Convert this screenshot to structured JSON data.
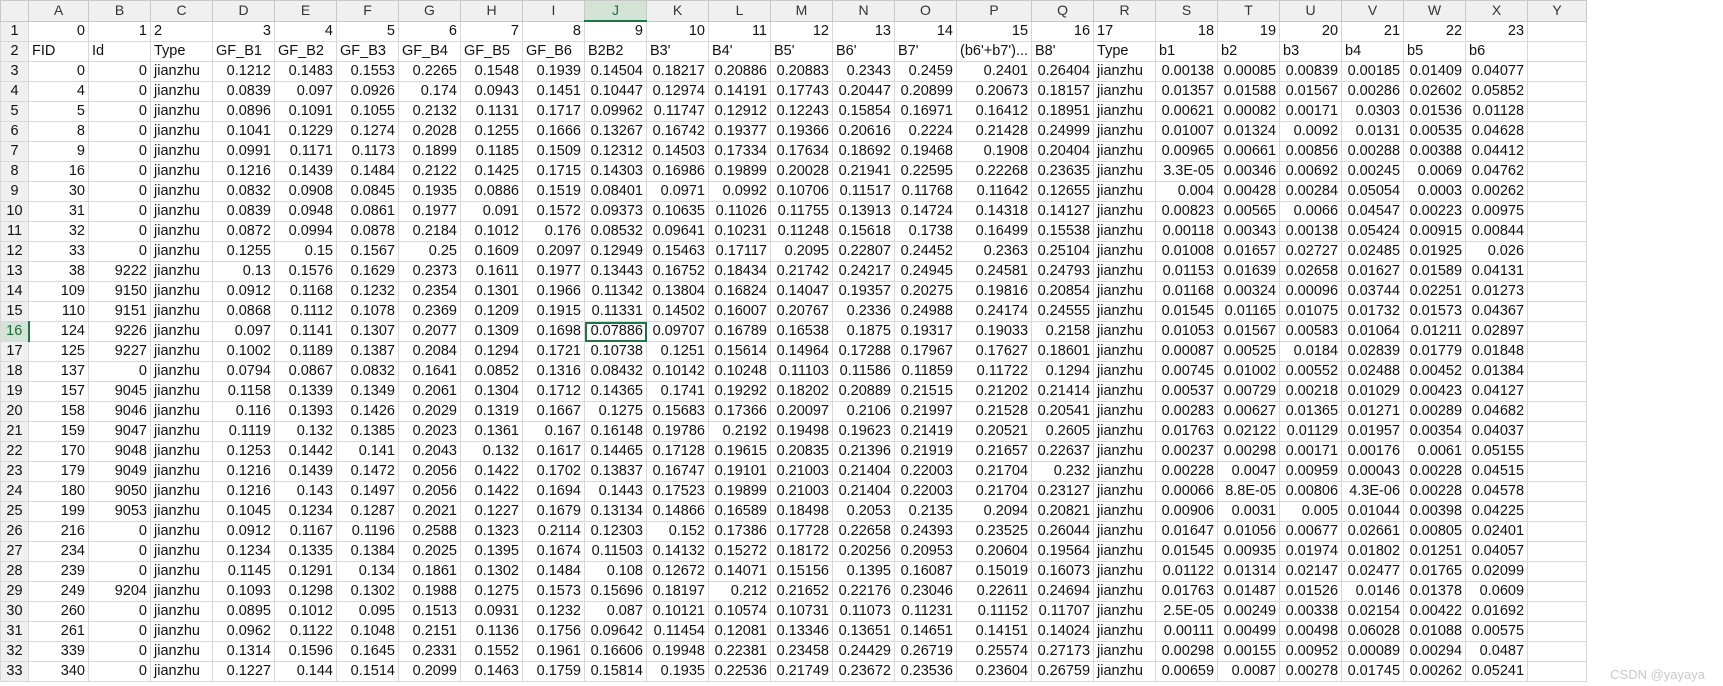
{
  "sheet": {
    "column_letters": [
      "A",
      "B",
      "C",
      "D",
      "E",
      "F",
      "G",
      "H",
      "I",
      "J",
      "K",
      "L",
      "M",
      "N",
      "O",
      "P",
      "Q",
      "R",
      "S",
      "T",
      "U",
      "V",
      "W",
      "X",
      "Y"
    ],
    "selected_column": "J",
    "selected_row": 16,
    "rows": [
      {
        "n": 1,
        "cells": [
          "0",
          "1",
          "2",
          "3",
          "4",
          "5",
          "6",
          "7",
          "8",
          "9",
          "10",
          "11",
          "12",
          "13",
          "14",
          "15",
          "16",
          "17",
          "18",
          "19",
          "20",
          "21",
          "22",
          "23",
          ""
        ]
      },
      {
        "n": 2,
        "cells": [
          "FID",
          "Id",
          "Type",
          "GF_B1",
          "GF_B2",
          "GF_B3",
          "GF_B4",
          "GF_B5",
          "GF_B6",
          "B2B2",
          "B3'",
          "B4'",
          "B5'",
          "B6'",
          "B7'",
          "(b6'+b7')...",
          "B8'",
          "Type",
          "b1",
          "b2",
          "b3",
          "b4",
          "b5",
          "b6",
          ""
        ]
      },
      {
        "n": 3,
        "cells": [
          "0",
          "0",
          "jianzhu",
          "0.1212",
          "0.1483",
          "0.1553",
          "0.2265",
          "0.1548",
          "0.1939",
          "0.14504",
          "0.18217",
          "0.20886",
          "0.20883",
          "0.2343",
          "0.2459",
          "0.2401",
          "0.26404",
          "jianzhu",
          "0.00138",
          "0.00085",
          "0.00839",
          "0.00185",
          "0.01409",
          "0.04077",
          ""
        ]
      },
      {
        "n": 4,
        "cells": [
          "4",
          "0",
          "jianzhu",
          "0.0839",
          "0.097",
          "0.0926",
          "0.174",
          "0.0943",
          "0.1451",
          "0.10447",
          "0.12974",
          "0.14191",
          "0.17743",
          "0.20447",
          "0.20899",
          "0.20673",
          "0.18157",
          "jianzhu",
          "0.01357",
          "0.01588",
          "0.01567",
          "0.00286",
          "0.02602",
          "0.05852",
          ""
        ]
      },
      {
        "n": 5,
        "cells": [
          "5",
          "0",
          "jianzhu",
          "0.0896",
          "0.1091",
          "0.1055",
          "0.2132",
          "0.1131",
          "0.1717",
          "0.09962",
          "0.11747",
          "0.12912",
          "0.12243",
          "0.15854",
          "0.16971",
          "0.16412",
          "0.18951",
          "jianzhu",
          "0.00621",
          "0.00082",
          "0.00171",
          "0.0303",
          "0.01536",
          "0.01128",
          ""
        ]
      },
      {
        "n": 6,
        "cells": [
          "8",
          "0",
          "jianzhu",
          "0.1041",
          "0.1229",
          "0.1274",
          "0.2028",
          "0.1255",
          "0.1666",
          "0.13267",
          "0.16742",
          "0.19377",
          "0.19366",
          "0.20616",
          "0.2224",
          "0.21428",
          "0.24999",
          "jianzhu",
          "0.01007",
          "0.01324",
          "0.0092",
          "0.0131",
          "0.00535",
          "0.04628",
          ""
        ]
      },
      {
        "n": 7,
        "cells": [
          "9",
          "0",
          "jianzhu",
          "0.0991",
          "0.1171",
          "0.1173",
          "0.1899",
          "0.1185",
          "0.1509",
          "0.12312",
          "0.14503",
          "0.17334",
          "0.17634",
          "0.18692",
          "0.19468",
          "0.1908",
          "0.20404",
          "jianzhu",
          "0.00965",
          "0.00661",
          "0.00856",
          "0.00288",
          "0.00388",
          "0.04412",
          ""
        ]
      },
      {
        "n": 8,
        "cells": [
          "16",
          "0",
          "jianzhu",
          "0.1216",
          "0.1439",
          "0.1484",
          "0.2122",
          "0.1425",
          "0.1715",
          "0.14303",
          "0.16986",
          "0.19899",
          "0.20028",
          "0.21941",
          "0.22595",
          "0.22268",
          "0.23635",
          "jianzhu",
          "3.3E-05",
          "0.00346",
          "0.00692",
          "0.00245",
          "0.0069",
          "0.04762",
          ""
        ]
      },
      {
        "n": 9,
        "cells": [
          "30",
          "0",
          "jianzhu",
          "0.0832",
          "0.0908",
          "0.0845",
          "0.1935",
          "0.0886",
          "0.1519",
          "0.08401",
          "0.0971",
          "0.0992",
          "0.10706",
          "0.11517",
          "0.11768",
          "0.11642",
          "0.12655",
          "jianzhu",
          "0.004",
          "0.00428",
          "0.00284",
          "0.05054",
          "0.0003",
          "0.00262",
          ""
        ]
      },
      {
        "n": 10,
        "cells": [
          "31",
          "0",
          "jianzhu",
          "0.0839",
          "0.0948",
          "0.0861",
          "0.1977",
          "0.091",
          "0.1572",
          "0.09373",
          "0.10635",
          "0.11026",
          "0.11755",
          "0.13913",
          "0.14724",
          "0.14318",
          "0.14127",
          "jianzhu",
          "0.00823",
          "0.00565",
          "0.0066",
          "0.04547",
          "0.00223",
          "0.00975",
          ""
        ]
      },
      {
        "n": 11,
        "cells": [
          "32",
          "0",
          "jianzhu",
          "0.0872",
          "0.0994",
          "0.0878",
          "0.2184",
          "0.1012",
          "0.176",
          "0.08532",
          "0.09641",
          "0.10231",
          "0.11248",
          "0.15618",
          "0.1738",
          "0.16499",
          "0.15538",
          "jianzhu",
          "0.00118",
          "0.00343",
          "0.00138",
          "0.05424",
          "0.00915",
          "0.00844",
          ""
        ]
      },
      {
        "n": 12,
        "cells": [
          "33",
          "0",
          "jianzhu",
          "0.1255",
          "0.15",
          "0.1567",
          "0.25",
          "0.1609",
          "0.2097",
          "0.12949",
          "0.15463",
          "0.17117",
          "0.2095",
          "0.22807",
          "0.24452",
          "0.2363",
          "0.25104",
          "jianzhu",
          "0.01008",
          "0.01657",
          "0.02727",
          "0.02485",
          "0.01925",
          "0.026",
          ""
        ]
      },
      {
        "n": 13,
        "cells": [
          "38",
          "9222",
          "jianzhu",
          "0.13",
          "0.1576",
          "0.1629",
          "0.2373",
          "0.1611",
          "0.1977",
          "0.13443",
          "0.16752",
          "0.18434",
          "0.21742",
          "0.24217",
          "0.24945",
          "0.24581",
          "0.24793",
          "jianzhu",
          "0.01153",
          "0.01639",
          "0.02658",
          "0.01627",
          "0.01589",
          "0.04131",
          ""
        ]
      },
      {
        "n": 14,
        "cells": [
          "109",
          "9150",
          "jianzhu",
          "0.0912",
          "0.1168",
          "0.1232",
          "0.2354",
          "0.1301",
          "0.1966",
          "0.11342",
          "0.13804",
          "0.16824",
          "0.14047",
          "0.19357",
          "0.20275",
          "0.19816",
          "0.20854",
          "jianzhu",
          "0.01168",
          "0.00324",
          "0.00096",
          "0.03744",
          "0.02251",
          "0.01273",
          ""
        ]
      },
      {
        "n": 15,
        "cells": [
          "110",
          "9151",
          "jianzhu",
          "0.0868",
          "0.1112",
          "0.1078",
          "0.2369",
          "0.1209",
          "0.1915",
          "0.11331",
          "0.14502",
          "0.16007",
          "0.20767",
          "0.2336",
          "0.24988",
          "0.24174",
          "0.24555",
          "jianzhu",
          "0.01545",
          "0.01165",
          "0.01075",
          "0.01732",
          "0.01573",
          "0.04367",
          ""
        ]
      },
      {
        "n": 16,
        "cells": [
          "124",
          "9226",
          "jianzhu",
          "0.097",
          "0.1141",
          "0.1307",
          "0.2077",
          "0.1309",
          "0.1698",
          "0.07886",
          "0.09707",
          "0.16789",
          "0.16538",
          "0.1875",
          "0.19317",
          "0.19033",
          "0.2158",
          "jianzhu",
          "0.01053",
          "0.01567",
          "0.00583",
          "0.01064",
          "0.01211",
          "0.02897",
          ""
        ]
      },
      {
        "n": 17,
        "cells": [
          "125",
          "9227",
          "jianzhu",
          "0.1002",
          "0.1189",
          "0.1387",
          "0.2084",
          "0.1294",
          "0.1721",
          "0.10738",
          "0.1251",
          "0.15614",
          "0.14964",
          "0.17288",
          "0.17967",
          "0.17627",
          "0.18601",
          "jianzhu",
          "0.00087",
          "0.00525",
          "0.0184",
          "0.02839",
          "0.01779",
          "0.01848",
          ""
        ]
      },
      {
        "n": 18,
        "cells": [
          "137",
          "0",
          "jianzhu",
          "0.0794",
          "0.0867",
          "0.0832",
          "0.1641",
          "0.0852",
          "0.1316",
          "0.08432",
          "0.10142",
          "0.10248",
          "0.11103",
          "0.11586",
          "0.11859",
          "0.11722",
          "0.1294",
          "jianzhu",
          "0.00745",
          "0.01002",
          "0.00552",
          "0.02488",
          "0.00452",
          "0.01384",
          ""
        ]
      },
      {
        "n": 19,
        "cells": [
          "157",
          "9045",
          "jianzhu",
          "0.1158",
          "0.1339",
          "0.1349",
          "0.2061",
          "0.1304",
          "0.1712",
          "0.14365",
          "0.1741",
          "0.19292",
          "0.18202",
          "0.20889",
          "0.21515",
          "0.21202",
          "0.21414",
          "jianzhu",
          "0.00537",
          "0.00729",
          "0.00218",
          "0.01029",
          "0.00423",
          "0.04127",
          ""
        ]
      },
      {
        "n": 20,
        "cells": [
          "158",
          "9046",
          "jianzhu",
          "0.116",
          "0.1393",
          "0.1426",
          "0.2029",
          "0.1319",
          "0.1667",
          "0.1275",
          "0.15683",
          "0.17366",
          "0.20097",
          "0.2106",
          "0.21997",
          "0.21528",
          "0.20541",
          "jianzhu",
          "0.00283",
          "0.00627",
          "0.01365",
          "0.01271",
          "0.00289",
          "0.04682",
          ""
        ]
      },
      {
        "n": 21,
        "cells": [
          "159",
          "9047",
          "jianzhu",
          "0.1119",
          "0.132",
          "0.1385",
          "0.2023",
          "0.1361",
          "0.167",
          "0.16148",
          "0.19786",
          "0.2192",
          "0.19498",
          "0.19623",
          "0.21419",
          "0.20521",
          "0.2605",
          "jianzhu",
          "0.01763",
          "0.02122",
          "0.01129",
          "0.01957",
          "0.00354",
          "0.04037",
          ""
        ]
      },
      {
        "n": 22,
        "cells": [
          "170",
          "9048",
          "jianzhu",
          "0.1253",
          "0.1442",
          "0.141",
          "0.2043",
          "0.132",
          "0.1617",
          "0.14465",
          "0.17128",
          "0.19615",
          "0.20835",
          "0.21396",
          "0.21919",
          "0.21657",
          "0.22637",
          "jianzhu",
          "0.00237",
          "0.00298",
          "0.00171",
          "0.00176",
          "0.0061",
          "0.05155",
          ""
        ]
      },
      {
        "n": 23,
        "cells": [
          "179",
          "9049",
          "jianzhu",
          "0.1216",
          "0.1439",
          "0.1472",
          "0.2056",
          "0.1422",
          "0.1702",
          "0.13837",
          "0.16747",
          "0.19101",
          "0.21003",
          "0.21404",
          "0.22003",
          "0.21704",
          "0.232",
          "jianzhu",
          "0.00228",
          "0.0047",
          "0.00959",
          "0.00043",
          "0.00228",
          "0.04515",
          ""
        ]
      },
      {
        "n": 24,
        "cells": [
          "180",
          "9050",
          "jianzhu",
          "0.1216",
          "0.143",
          "0.1497",
          "0.2056",
          "0.1422",
          "0.1694",
          "0.1443",
          "0.17523",
          "0.19899",
          "0.21003",
          "0.21404",
          "0.22003",
          "0.21704",
          "0.23127",
          "jianzhu",
          "0.00066",
          "8.8E-05",
          "0.00806",
          "4.3E-06",
          "0.00228",
          "0.04578",
          ""
        ]
      },
      {
        "n": 25,
        "cells": [
          "199",
          "9053",
          "jianzhu",
          "0.1045",
          "0.1234",
          "0.1287",
          "0.2021",
          "0.1227",
          "0.1679",
          "0.13134",
          "0.14866",
          "0.16589",
          "0.18498",
          "0.2053",
          "0.2135",
          "0.2094",
          "0.20821",
          "jianzhu",
          "0.00906",
          "0.0031",
          "0.005",
          "0.01044",
          "0.00398",
          "0.04225",
          ""
        ]
      },
      {
        "n": 26,
        "cells": [
          "216",
          "0",
          "jianzhu",
          "0.0912",
          "0.1167",
          "0.1196",
          "0.2588",
          "0.1323",
          "0.2114",
          "0.12303",
          "0.152",
          "0.17386",
          "0.17728",
          "0.22658",
          "0.24393",
          "0.23525",
          "0.26044",
          "jianzhu",
          "0.01647",
          "0.01056",
          "0.00677",
          "0.02661",
          "0.00805",
          "0.02401",
          ""
        ]
      },
      {
        "n": 27,
        "cells": [
          "234",
          "0",
          "jianzhu",
          "0.1234",
          "0.1335",
          "0.1384",
          "0.2025",
          "0.1395",
          "0.1674",
          "0.11503",
          "0.14132",
          "0.15272",
          "0.18172",
          "0.20256",
          "0.20953",
          "0.20604",
          "0.19564",
          "jianzhu",
          "0.01545",
          "0.00935",
          "0.01974",
          "0.01802",
          "0.01251",
          "0.04057",
          ""
        ]
      },
      {
        "n": 28,
        "cells": [
          "239",
          "0",
          "jianzhu",
          "0.1145",
          "0.1291",
          "0.134",
          "0.1861",
          "0.1302",
          "0.1484",
          "0.108",
          "0.12672",
          "0.14071",
          "0.15156",
          "0.1395",
          "0.16087",
          "0.15019",
          "0.16073",
          "jianzhu",
          "0.01122",
          "0.01314",
          "0.02147",
          "0.02477",
          "0.01765",
          "0.02099",
          ""
        ]
      },
      {
        "n": 29,
        "cells": [
          "249",
          "9204",
          "jianzhu",
          "0.1093",
          "0.1298",
          "0.1302",
          "0.1988",
          "0.1275",
          "0.1573",
          "0.15696",
          "0.18197",
          "0.212",
          "0.21652",
          "0.22176",
          "0.23046",
          "0.22611",
          "0.24694",
          "jianzhu",
          "0.01763",
          "0.01487",
          "0.01526",
          "0.0146",
          "0.01378",
          "0.0609",
          ""
        ]
      },
      {
        "n": 30,
        "cells": [
          "260",
          "0",
          "jianzhu",
          "0.0895",
          "0.1012",
          "0.095",
          "0.1513",
          "0.0931",
          "0.1232",
          "0.087",
          "0.10121",
          "0.10574",
          "0.10731",
          "0.11073",
          "0.11231",
          "0.11152",
          "0.11707",
          "jianzhu",
          "2.5E-05",
          "0.00249",
          "0.00338",
          "0.02154",
          "0.00422",
          "0.01692",
          ""
        ]
      },
      {
        "n": 31,
        "cells": [
          "261",
          "0",
          "jianzhu",
          "0.0962",
          "0.1122",
          "0.1048",
          "0.2151",
          "0.1136",
          "0.1756",
          "0.09642",
          "0.11454",
          "0.12081",
          "0.13346",
          "0.13651",
          "0.14651",
          "0.14151",
          "0.14024",
          "jianzhu",
          "0.00111",
          "0.00499",
          "0.00498",
          "0.06028",
          "0.01088",
          "0.00575",
          ""
        ]
      },
      {
        "n": 32,
        "cells": [
          "339",
          "0",
          "jianzhu",
          "0.1314",
          "0.1596",
          "0.1645",
          "0.2331",
          "0.1552",
          "0.1961",
          "0.16606",
          "0.19948",
          "0.22381",
          "0.23458",
          "0.24429",
          "0.26719",
          "0.25574",
          "0.27173",
          "jianzhu",
          "0.00298",
          "0.00155",
          "0.00952",
          "0.00089",
          "0.00294",
          "0.0487",
          ""
        ]
      },
      {
        "n": 33,
        "cells": [
          "340",
          "0",
          "jianzhu",
          "0.1227",
          "0.144",
          "0.1514",
          "0.2099",
          "0.1463",
          "0.1759",
          "0.15814",
          "0.1935",
          "0.22536",
          "0.21749",
          "0.23672",
          "0.23536",
          "0.23604",
          "0.26759",
          "jianzhu",
          "0.00659",
          "0.0087",
          "0.00278",
          "0.01745",
          "0.00262",
          "0.05241",
          ""
        ]
      }
    ]
  },
  "watermark": "CSDN @yayaya"
}
